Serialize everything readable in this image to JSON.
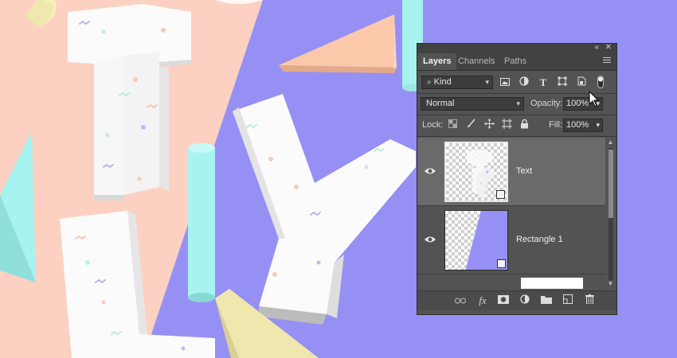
{
  "colors": {
    "bg_purple": "#9690f4",
    "bg_peach": "#fdd1c2",
    "panel": "#535353",
    "cyan": "#a7f3ef",
    "yellow": "#efe7ad",
    "orange_shape": "#fbc9a9"
  },
  "panel": {
    "tabs": [
      {
        "label": "Layers",
        "active": true
      },
      {
        "label": "Channels",
        "active": false
      },
      {
        "label": "Paths",
        "active": false
      }
    ],
    "filter": {
      "label": "Kind",
      "icon": "search-icon"
    },
    "blend_mode": "Normal",
    "opacity_label": "Opacity:",
    "opacity_value": "100%",
    "lock_label": "Lock:",
    "fill_label": "Fill:",
    "fill_value": "100%",
    "layers": [
      {
        "name": "Text",
        "selected": true,
        "visible": true
      },
      {
        "name": "Rectangle 1",
        "selected": false,
        "visible": true
      }
    ],
    "bottom_icons": [
      "link-icon",
      "fx-icon",
      "mask-icon",
      "adjustment-icon",
      "folder-icon",
      "new-layer-icon",
      "trash-icon"
    ],
    "fx_label": "fx"
  }
}
